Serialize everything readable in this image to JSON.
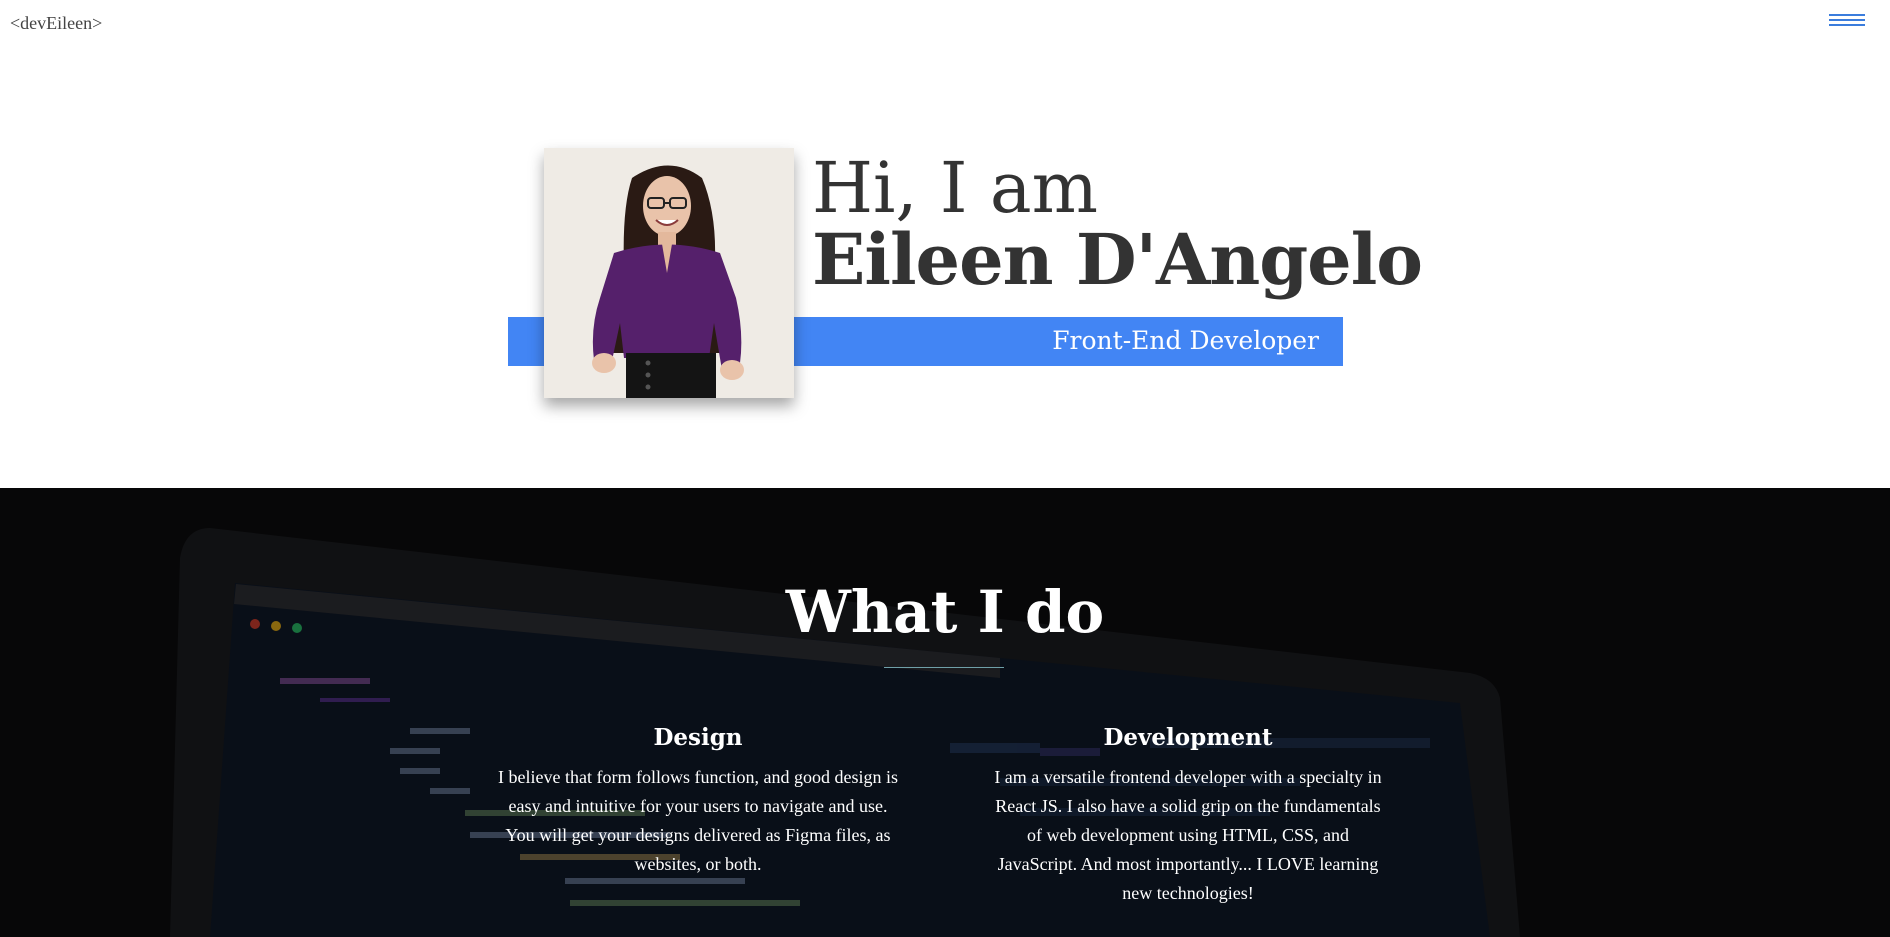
{
  "header": {
    "logo": "<devEileen>",
    "menu_icon": "hamburger-icon",
    "accent_color": "#4285f4"
  },
  "hero": {
    "greeting": "Hi, I am",
    "name": "Eileen D'Angelo",
    "role": "Front-End Developer",
    "photo": "profile-photo"
  },
  "services": {
    "title": "What I do",
    "columns": [
      {
        "heading": "Design",
        "text": "I believe that form follows function, and good design is easy and intuitive for your users to navigate and use. You will get your designs delivered as Figma files, as websites, or both."
      },
      {
        "heading": "Development",
        "text": "I am a versatile frontend developer with a specialty in React JS. I also have a solid grip on the fundamentals of web development using HTML, CSS, and JavaScript. And most importantly... I LOVE learning new technologies!"
      }
    ]
  }
}
